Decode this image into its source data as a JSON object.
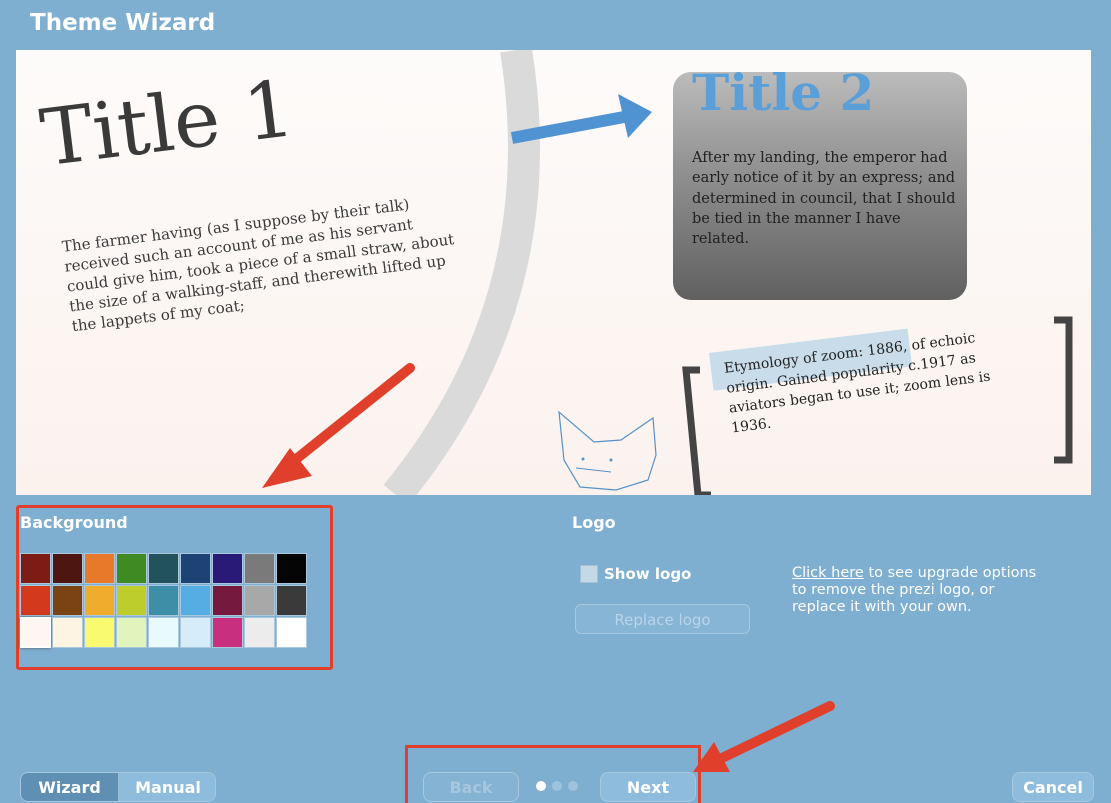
{
  "window": {
    "title": "Theme Wizard"
  },
  "preview": {
    "title1": "Title 1",
    "paragraph1": "The farmer having (as I suppose by their talk) received such an account of me as his servant could give him, took a piece of a small straw, about the size of a walking-staff, and therewith lifted up the lappets of my coat;",
    "title2": "Title 2",
    "paragraph2": "After my landing, the emperor had early notice of it by an express; and determined in council, that I should be tied in the manner I have related.",
    "quote": "Etymology of zoom: 1886, of echoic origin. Gained popularity c.1917 as aviators began to use it; zoom lens is 1936."
  },
  "background": {
    "label": "Background",
    "swatches": [
      "#7c1c14",
      "#4d1610",
      "#e8782a",
      "#3f8a23",
      "#22525c",
      "#1d4276",
      "#2a1a78",
      "#7a7a7a",
      "#050505",
      "#d2391d",
      "#7a4313",
      "#f0ad2d",
      "#bccd2c",
      "#3e8ea8",
      "#55ade4",
      "#751a3e",
      "#a8a8a8",
      "#3a3a3a",
      "#fdf6f2",
      "#fdf4e2",
      "#fafa70",
      "#e2f4be",
      "#e9fafd",
      "#d6ecf9",
      "#c92f7f",
      "#ececec",
      "#ffffff"
    ],
    "selected_index": 18
  },
  "logo": {
    "label": "Logo",
    "show_logo_label": "Show logo",
    "show_logo_checked": false,
    "replace_logo_label": "Replace logo",
    "upgrade_link": "Click here",
    "upgrade_text": " to see upgrade options to remove the prezi logo, or replace it with your own."
  },
  "footer": {
    "wizard_label": "Wizard",
    "manual_label": "Manual",
    "back_label": "Back",
    "next_label": "Next",
    "cancel_label": "Cancel",
    "step_count": 3,
    "current_step": 1
  },
  "colors": {
    "background": "#7eaed0",
    "annotation_red": "#e0402b",
    "arrow_blue": "#4f93d2"
  }
}
